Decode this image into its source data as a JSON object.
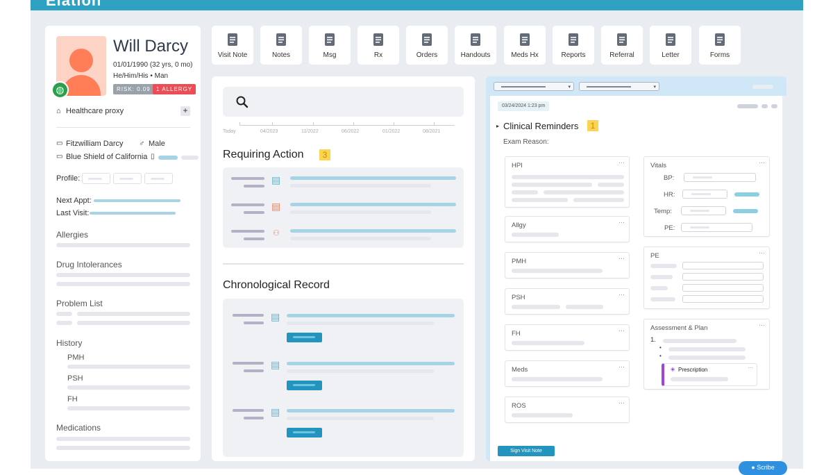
{
  "app": {
    "logo": "Elation"
  },
  "patient": {
    "name": "Will Darcy",
    "dob": "01/01/1990 (32 yrs, 0 mo)",
    "pronouns_sex": "He/Him/His • Man",
    "risk": "RISK: 0.09",
    "allergy_badge": "1 ALLERGY",
    "healthcare_proxy": "Healthcare proxy",
    "full_name": "Fitzwilliam Darcy",
    "sex": "Male",
    "insurance": "Blue Shield of California",
    "profile_label": "Profile:",
    "next_appt_label": "Next Appt:",
    "last_visit_label": "Last Visit:",
    "sections": {
      "allergies": "Allergies",
      "drug_intolerances": "Drug Intolerances",
      "problem_list": "Problem List",
      "history": "History",
      "pmh": "PMH",
      "psh": "PSH",
      "fh": "FH",
      "medications": "Medications"
    }
  },
  "toolbar": [
    {
      "label": "Visit Note",
      "icon": "document-icon"
    },
    {
      "label": "Notes",
      "icon": "file-icon"
    },
    {
      "label": "Msg",
      "icon": "chat-icon"
    },
    {
      "label": "Rx",
      "icon": "pill-icon"
    },
    {
      "label": "Orders",
      "icon": "orders-icon"
    },
    {
      "label": "Handouts",
      "icon": "stack-icon"
    },
    {
      "label": "Meds Hx",
      "icon": "meds-icon"
    },
    {
      "label": "Reports",
      "icon": "clipboard-icon"
    },
    {
      "label": "Referral",
      "icon": "referral-icon"
    },
    {
      "label": "Letter",
      "icon": "envelope-icon"
    },
    {
      "label": "Forms",
      "icon": "form-icon"
    }
  ],
  "timeline": [
    "Today",
    "04/2023",
    "11/2022",
    "06/2022",
    "01/2022",
    "08/2021"
  ],
  "requiring_action": {
    "title": "Requiring Action",
    "count": "3"
  },
  "chronological": {
    "title": "Chronological Record"
  },
  "visit": {
    "date": "03/24/2024 1:23 pm",
    "clinical_reminders": "Clinical Reminders",
    "reminder_count": "1",
    "exam_reason": "Exam Reason:",
    "cards_left": [
      "HPI",
      "Allgy",
      "PMH",
      "PSH",
      "FH",
      "Meds",
      "ROS"
    ],
    "vitals": {
      "title": "Vitals",
      "bp": "BP:",
      "hr": "HR:",
      "temp": "Temp:",
      "pe": "PE:"
    },
    "pe_title": "PE",
    "assessment_title": "Assessment & Plan",
    "assessment_num": "1.",
    "prescription": "Prescription",
    "sign_button": "Sign Visit Note"
  },
  "scribe": "Scribe"
}
